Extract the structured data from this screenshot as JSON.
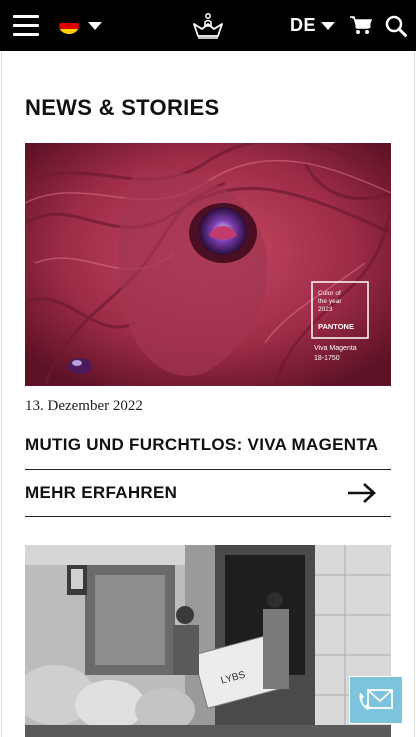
{
  "header": {
    "language_code": "DE",
    "icons": [
      "menu-icon",
      "germany-flag-icon",
      "chevron-down-icon",
      "crown-logo-icon",
      "cart-icon",
      "search-icon"
    ]
  },
  "section": {
    "title": "NEWS & STORIES"
  },
  "articles": [
    {
      "date": "13. Dezember 2022",
      "headline": "MUTIG UND FURCHTLOS: VIVA MAGENTA",
      "more_label": "MEHR ERFAHREN",
      "image_overlay": {
        "line1": "Color of the year 2023",
        "brand": "PANTONE",
        "name": "Viva Magenta",
        "code": "18-1750"
      }
    },
    {
      "image_overlay": {
        "crate_text": "LYBS"
      }
    }
  ],
  "colors": {
    "topbar": "#000000",
    "magenta": "#a8334f",
    "contact_button": "#7cc3de"
  }
}
